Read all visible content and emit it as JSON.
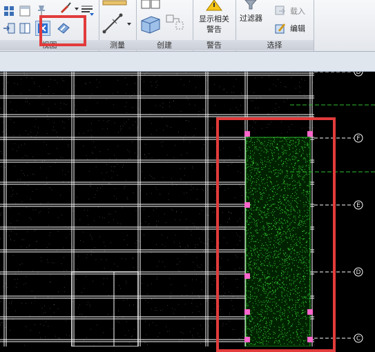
{
  "ribbon": {
    "groups": [
      {
        "id": "view",
        "label": "视图"
      },
      {
        "id": "measure",
        "label": "测量"
      },
      {
        "id": "create",
        "label": "创建"
      },
      {
        "id": "warning",
        "label": "警告"
      },
      {
        "id": "select",
        "label": "选择"
      }
    ],
    "buttons": {
      "show_warnings": "显示相关\n警告",
      "show_warnings_line1": "显示相关",
      "show_warnings_line2": "警告",
      "filter": "过滤器",
      "load": "载入",
      "edit": "编辑"
    }
  },
  "grid_labels": [
    "D",
    "F",
    "E",
    "D",
    "C"
  ],
  "colors": {
    "highlight": "#e23b3b",
    "grid_line": "#ffffff",
    "hatch": "#39d639",
    "grip": "#ff66cc"
  }
}
